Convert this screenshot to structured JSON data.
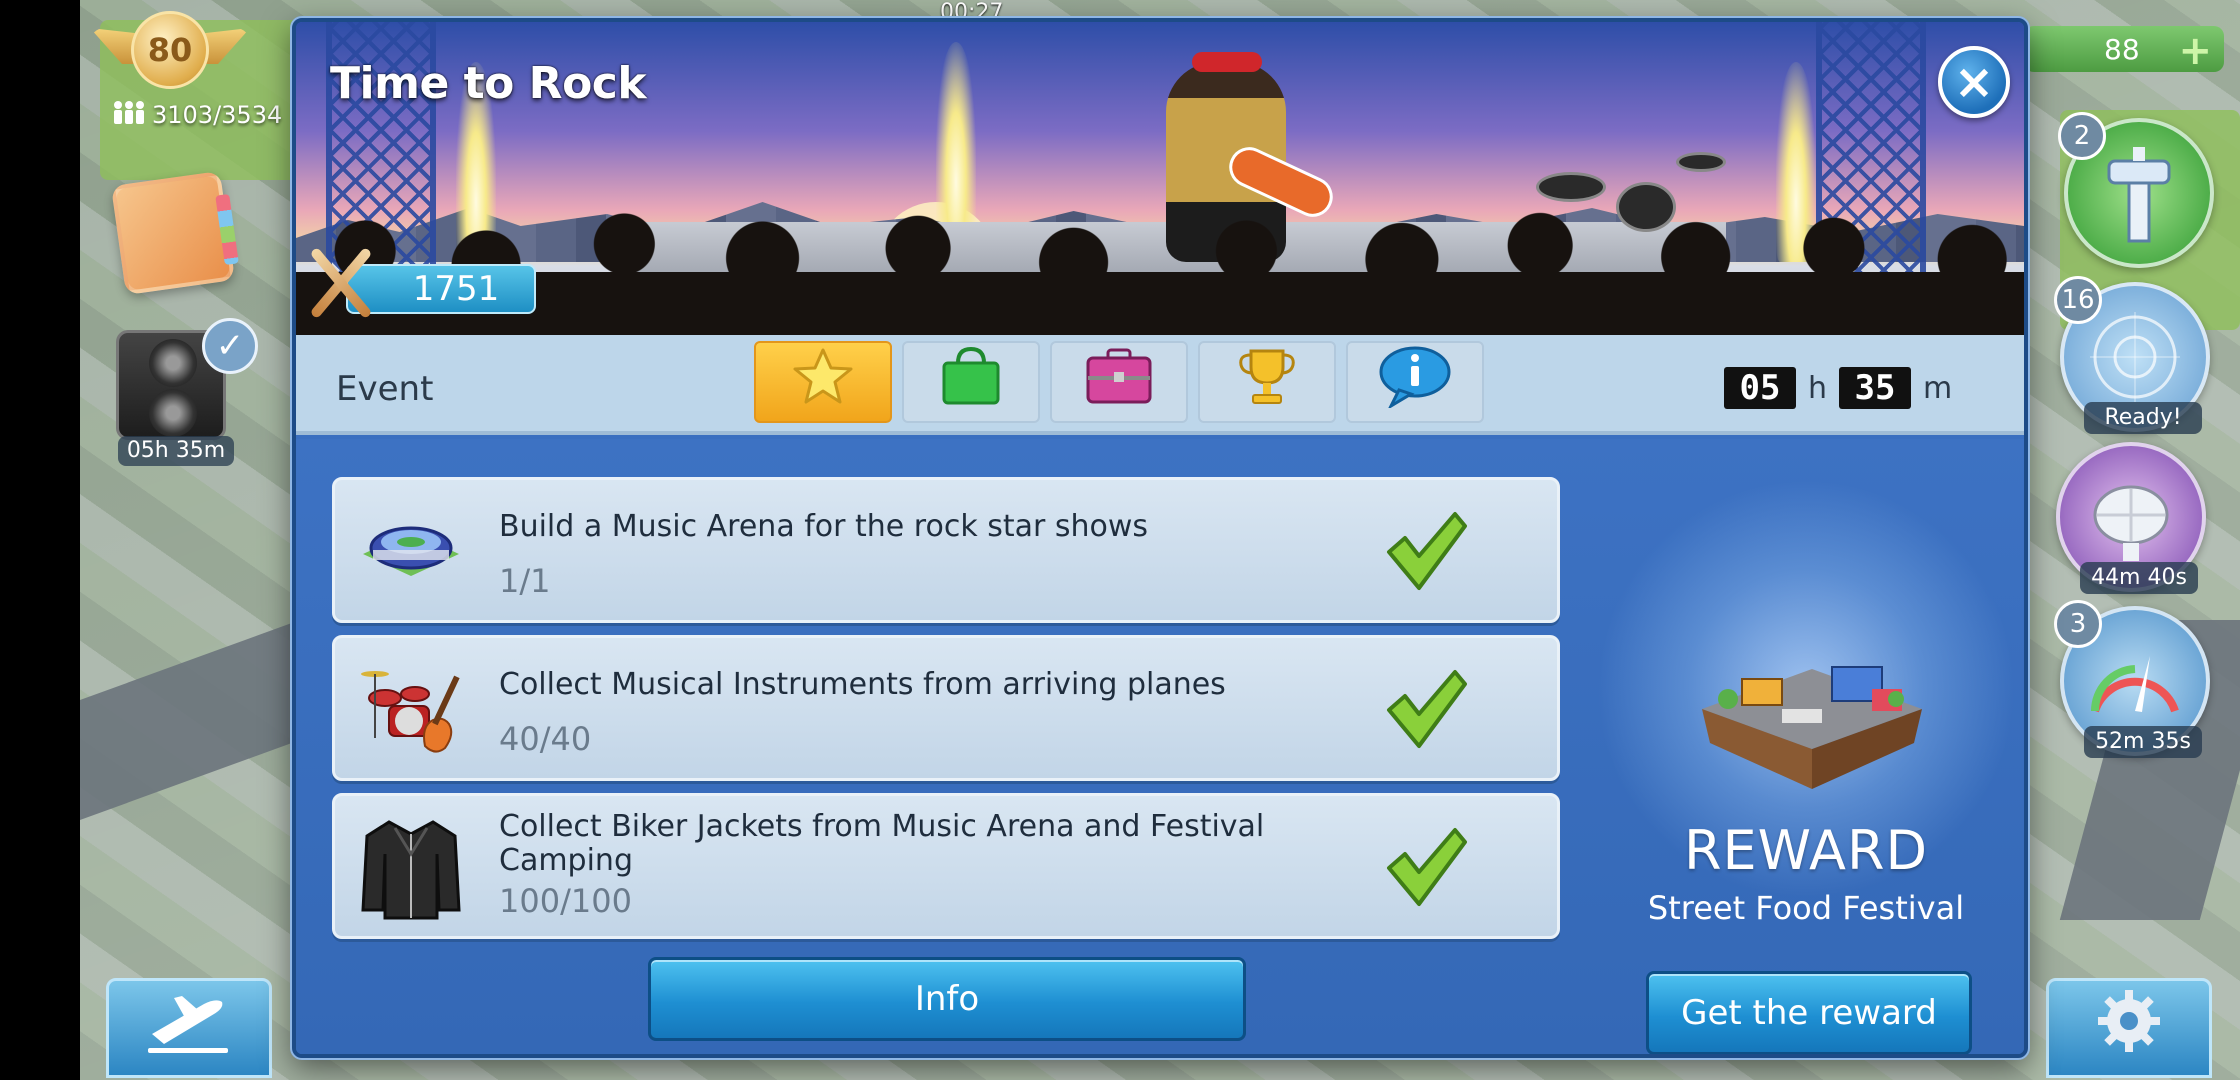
{
  "hud": {
    "level": "80",
    "population": "3103/3534",
    "left_timer": "05h 35m",
    "clock": "00:27",
    "coins": "88",
    "coins_plus": "+",
    "right_buttons": [
      {
        "count": "2",
        "label": "",
        "icon": "control-tower-icon"
      },
      {
        "count": "16",
        "label": "Ready!",
        "icon": "radar-icon"
      },
      {
        "count": "",
        "label": "44m 40s",
        "icon": "satellite-dish-icon"
      },
      {
        "count": "3",
        "label": "52m 35s",
        "icon": "speedometer-icon"
      }
    ]
  },
  "modal": {
    "title": "Time to Rock",
    "score": "1751",
    "close_label": "×",
    "tab_bar": {
      "event_label": "Event",
      "tabs": [
        {
          "icon": "star-icon",
          "active": true
        },
        {
          "icon": "shopping-bag-icon",
          "active": false
        },
        {
          "icon": "guitar-case-icon",
          "active": false
        },
        {
          "icon": "trophy-icon",
          "active": false
        },
        {
          "icon": "info-bubble-icon",
          "active": false
        }
      ],
      "countdown": {
        "hours": "05",
        "hours_unit": "h",
        "minutes": "35",
        "minutes_unit": "m"
      }
    },
    "tasks": [
      {
        "title": "Build a Music Arena for the rock star shows",
        "progress": "1/1",
        "icon": "music-arena-icon",
        "completed": true
      },
      {
        "title": "Collect Musical Instruments from arriving planes",
        "progress": "40/40",
        "icon": "drum-kit-icon",
        "completed": true
      },
      {
        "title": "Collect Biker Jackets from Music Arena and Festival Camping",
        "progress": "100/100",
        "icon": "biker-jacket-icon",
        "completed": true
      }
    ],
    "info_button": "Info",
    "reward": {
      "heading": "REWARD",
      "name": "Street Food Festival",
      "button": "Get the reward"
    }
  },
  "colors": {
    "panel_blue": "#3a6fc0",
    "tab_bar": "#bdd6ea",
    "active_tab": "#f1a51b",
    "button_blue": "#1e8fd2",
    "check_green": "#7cc62a"
  }
}
